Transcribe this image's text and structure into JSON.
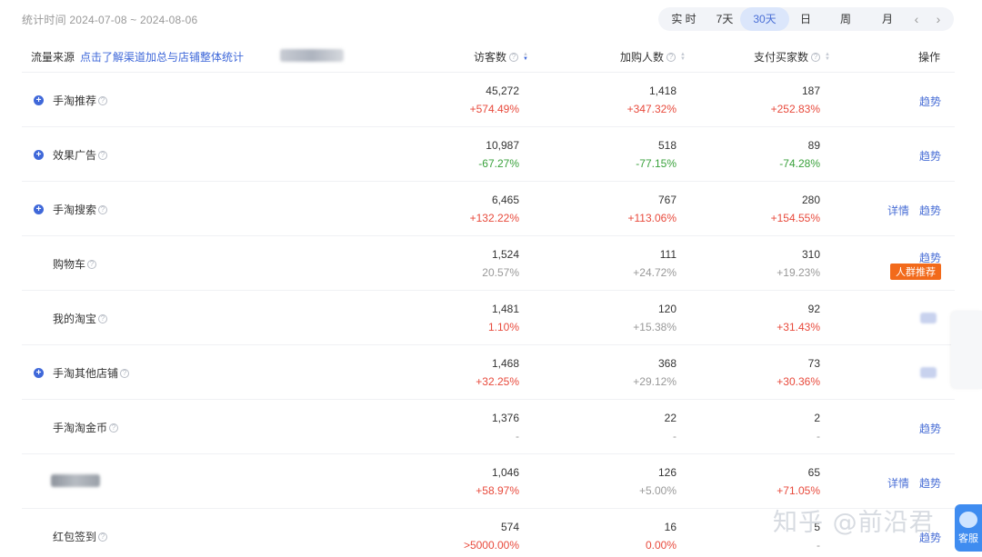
{
  "stat_time": "统计时间 2024-07-08 ~ 2024-08-06",
  "range_tabs": [
    {
      "label": "实 时",
      "active": false
    },
    {
      "label": "7天",
      "active": false
    },
    {
      "label": "30天",
      "active": true
    },
    {
      "label": "日",
      "active": false
    },
    {
      "label": "周",
      "active": false
    },
    {
      "label": "月",
      "active": false
    }
  ],
  "range_prev": "‹",
  "range_next": "›",
  "header": {
    "source": "流量来源",
    "link": "点击了解渠道加总与店铺整体统计",
    "visitors": "访客数",
    "add_cart": "加购人数",
    "buyers": "支付买家数",
    "ops": "操作"
  },
  "rows": [
    {
      "name": "手淘推荐",
      "expand": true,
      "visitors": "45,272",
      "visitors_pct": "+574.49%",
      "v_dir": "up",
      "cart": "1,418",
      "cart_pct": "+347.32%",
      "c_dir": "up",
      "buyers": "187",
      "buyers_pct": "+252.83%",
      "b_dir": "up",
      "ops": [
        "趋势"
      ]
    },
    {
      "name": "效果广告",
      "expand": true,
      "visitors": "10,987",
      "visitors_pct": "-67.27%",
      "v_dir": "down",
      "cart": "518",
      "cart_pct": "-77.15%",
      "c_dir": "down",
      "buyers": "89",
      "buyers_pct": "-74.28%",
      "b_dir": "down",
      "ops": [
        "趋势"
      ]
    },
    {
      "name": "手淘搜索",
      "expand": true,
      "visitors": "6,465",
      "visitors_pct": "+132.22%",
      "v_dir": "up",
      "cart": "767",
      "cart_pct": "+113.06%",
      "c_dir": "up",
      "buyers": "280",
      "buyers_pct": "+154.55%",
      "b_dir": "up",
      "ops": [
        "详情",
        "趋势"
      ]
    },
    {
      "name": "购物车",
      "expand": false,
      "visitors": "1,524",
      "visitors_pct": "20.57%",
      "v_dir": "neutral",
      "cart": "111",
      "cart_pct": "+24.72%",
      "c_dir": "neutral",
      "buyers": "310",
      "buyers_pct": "+19.23%",
      "b_dir": "neutral",
      "ops": [
        "趋势"
      ],
      "badge": "人群推荐"
    },
    {
      "name": "我的淘宝",
      "expand": false,
      "visitors": "1,481",
      "visitors_pct": "1.10%",
      "v_dir": "up",
      "cart": "120",
      "cart_pct": "+15.38%",
      "c_dir": "neutral",
      "buyers": "92",
      "buyers_pct": "+31.43%",
      "b_dir": "up",
      "ops": []
    },
    {
      "name": "手淘其他店铺",
      "expand": true,
      "visitors": "1,468",
      "visitors_pct": "+32.25%",
      "v_dir": "up",
      "cart": "368",
      "cart_pct": "+29.12%",
      "c_dir": "neutral",
      "buyers": "73",
      "buyers_pct": "+30.36%",
      "b_dir": "up",
      "ops": []
    },
    {
      "name": "手淘淘金币",
      "expand": false,
      "visitors": "1,376",
      "visitors_pct": "-",
      "v_dir": "neutral",
      "cart": "22",
      "cart_pct": "-",
      "c_dir": "neutral",
      "buyers": "2",
      "buyers_pct": "-",
      "b_dir": "neutral",
      "ops": [
        "趋势"
      ]
    },
    {
      "name": "",
      "expand": false,
      "visitors": "1,046",
      "visitors_pct": "+58.97%",
      "v_dir": "up",
      "cart": "126",
      "cart_pct": "+5.00%",
      "c_dir": "neutral",
      "buyers": "65",
      "buyers_pct": "+71.05%",
      "b_dir": "up",
      "ops": [
        "详情",
        "趋势"
      ]
    },
    {
      "name": "红包签到",
      "expand": false,
      "visitors": "574",
      "visitors_pct": ">5000.00%",
      "v_dir": "up",
      "cart": "16",
      "cart_pct": "0.00%",
      "c_dir": "up",
      "buyers": "5",
      "buyers_pct": "-",
      "b_dir": "neutral",
      "ops": [
        "趋势"
      ]
    }
  ],
  "watermark": "知乎 @前沿君",
  "service_label": "客服"
}
